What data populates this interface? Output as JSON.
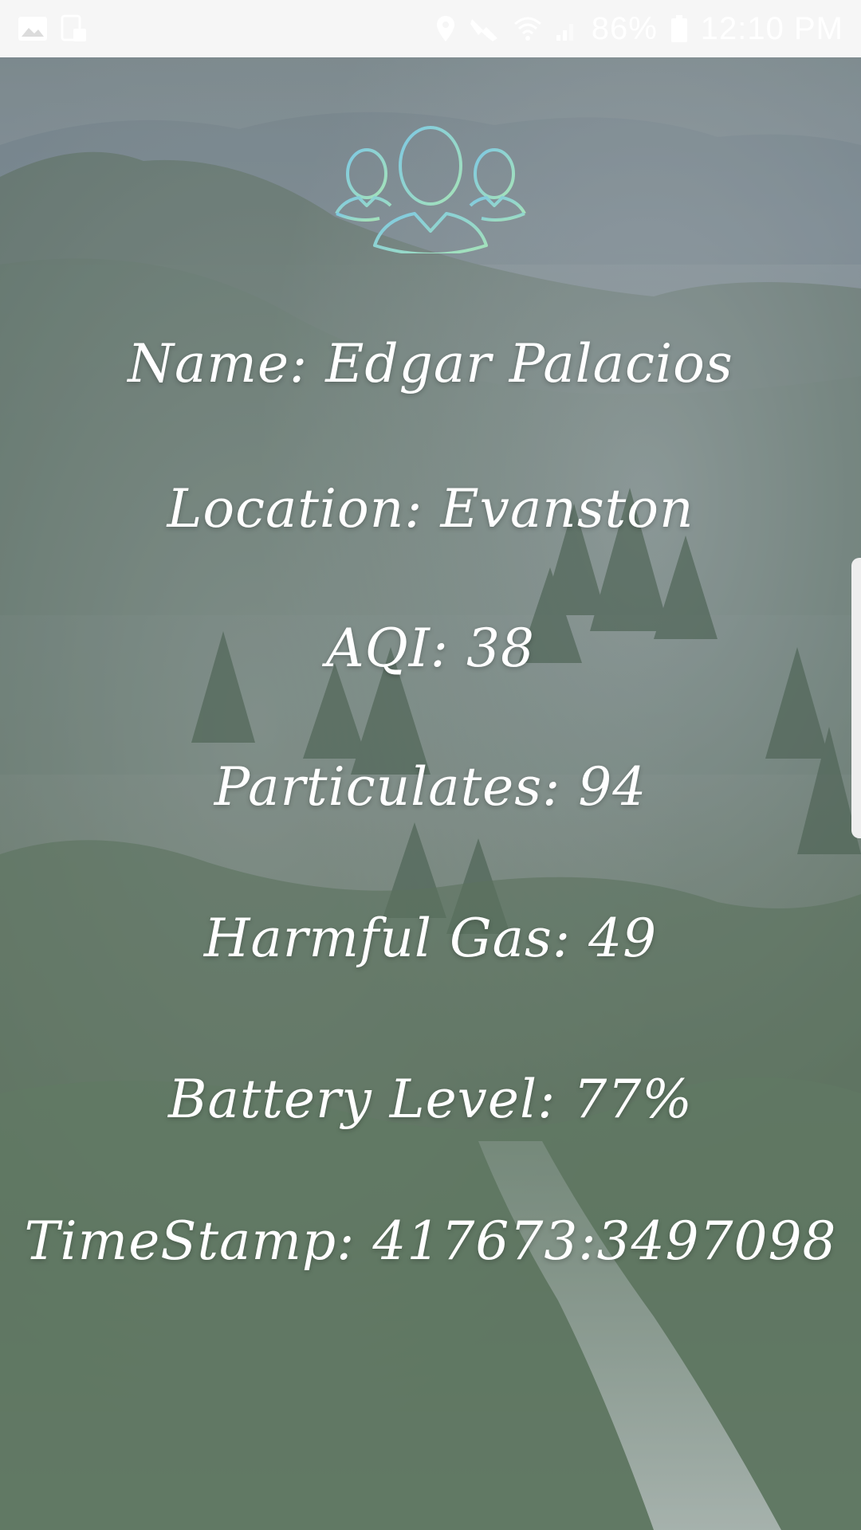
{
  "status_bar": {
    "left_icons": [
      "gallery-icon",
      "screenshot-icon"
    ],
    "right_icons": [
      "location-icon",
      "mute-icon",
      "wifi-icon",
      "signal-icon",
      "battery-icon"
    ],
    "battery_percent_text": "86%",
    "time": "12:10 PM"
  },
  "header": {
    "icon": "user-group-icon",
    "icon_colors": [
      "#7ec8e3",
      "#a6e3b8"
    ]
  },
  "info": {
    "name": "Name: Edgar Palacios",
    "location": "Location: Evanston",
    "aqi": "AQI: 38",
    "particulates": "Particulates: 94",
    "harmful_gas": "Harmful Gas: 49",
    "battery_level": "Battery Level: 77%",
    "timestamp": "TimeStamp: 417673:3497098"
  },
  "colors": {
    "status_bar_bg": "#f6f6f6",
    "text": "#ffffff",
    "overlay": "#6f7f7c"
  }
}
